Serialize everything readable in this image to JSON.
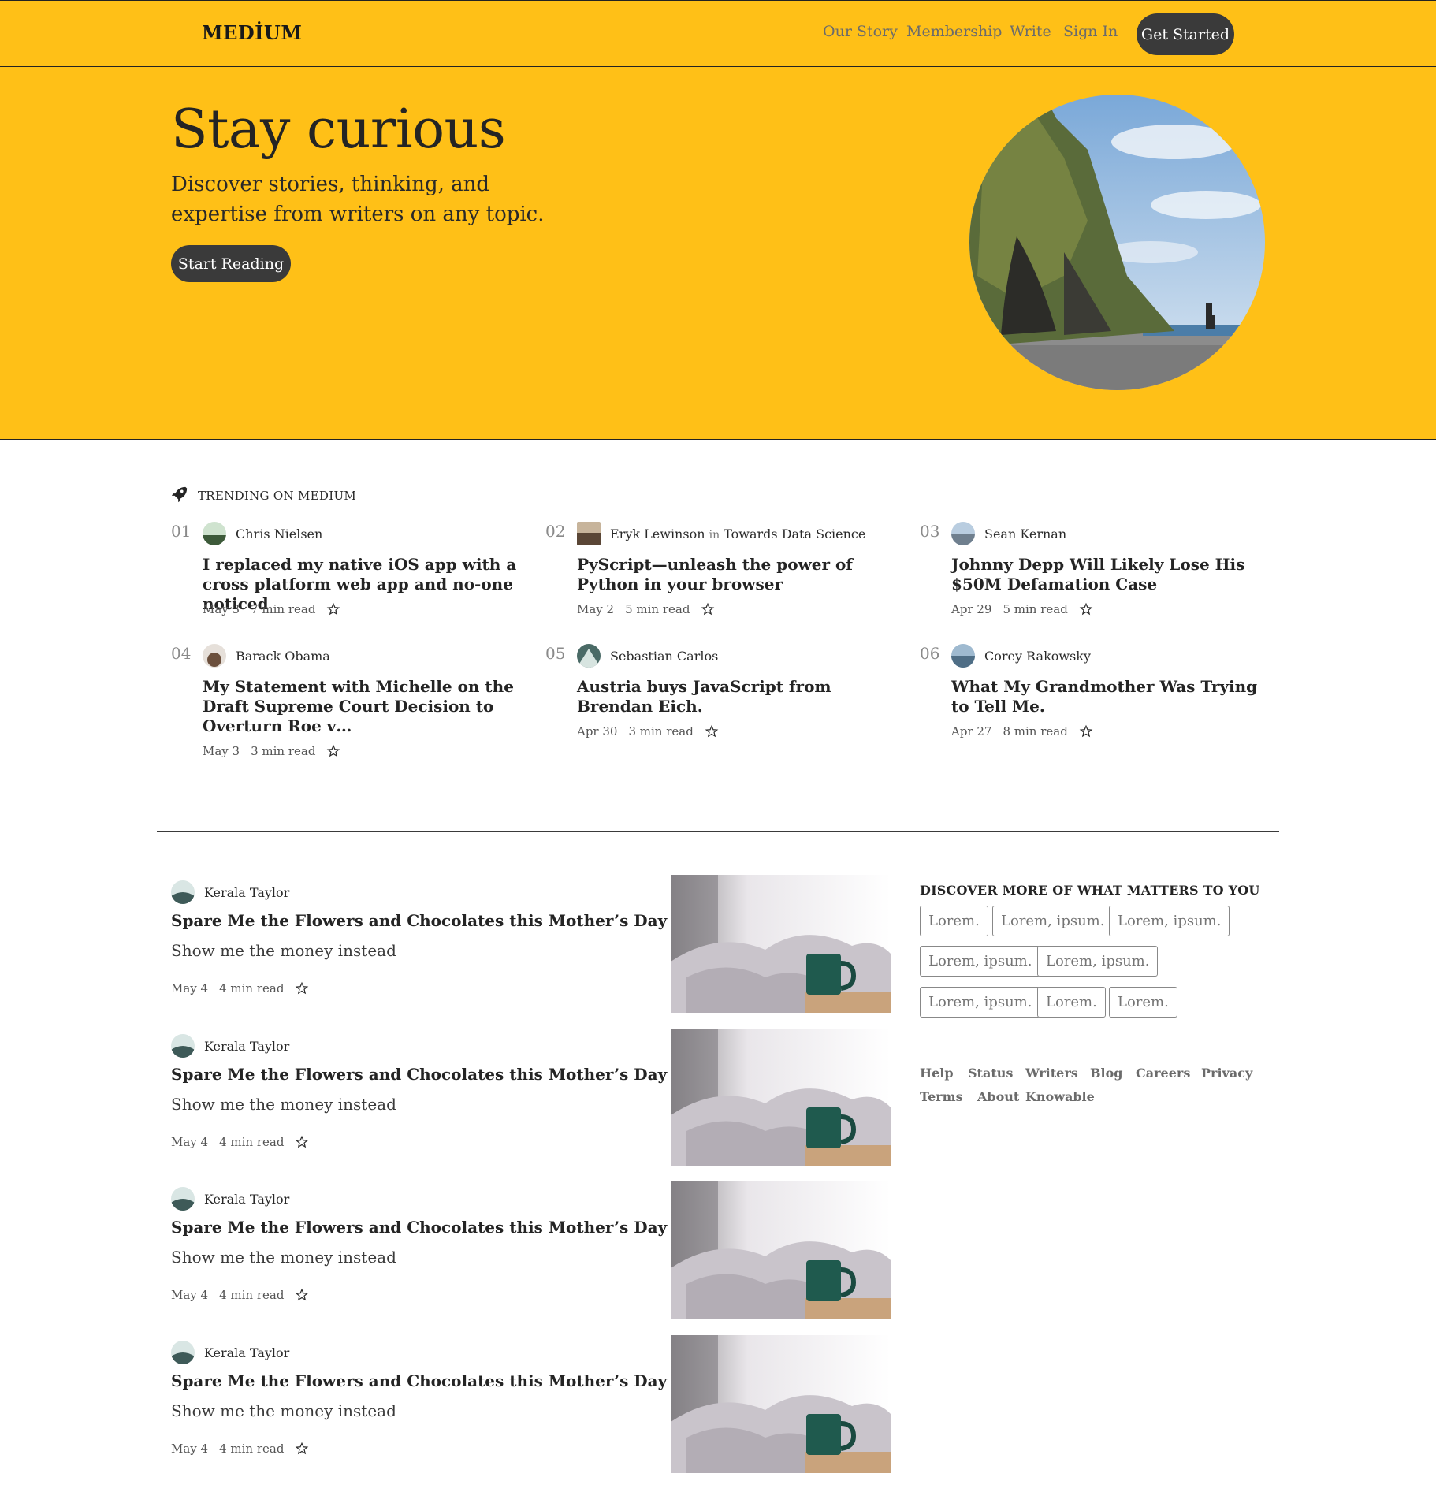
{
  "nav": {
    "logo": "MEDİUM",
    "links": [
      "Our Story",
      "Membership",
      "Write",
      "Sign In"
    ],
    "cta": "Get Started"
  },
  "hero": {
    "title": "Stay curious",
    "subtitle": "Discover stories, thinking, and expertise from writers on any topic.",
    "button": "Start Reading"
  },
  "trending": {
    "heading": "TRENDING ON MEDIUM",
    "items": [
      {
        "num": "01",
        "author": "Chris Nielsen",
        "in": "",
        "publication": "",
        "title": "I replaced my native iOS app with a cross platform web app and no-one noticed",
        "date": "May 3",
        "read": "7 min read"
      },
      {
        "num": "02",
        "author": "Eryk Lewinson",
        "in": "in",
        "publication": "Towards Data Science",
        "title": "PyScript—unleash the power of Python in your browser",
        "date": "May 2",
        "read": "5 min read"
      },
      {
        "num": "03",
        "author": "Sean Kernan",
        "in": "",
        "publication": "",
        "title": "Johnny Depp Will Likely Lose His $50M Defamation Case",
        "date": "Apr 29",
        "read": "5 min read"
      },
      {
        "num": "04",
        "author": "Barack Obama",
        "in": "",
        "publication": "",
        "title": "My Statement with Michelle on the Draft Supreme Court Decision to Overturn Roe v…",
        "date": "May 3",
        "read": "3 min read"
      },
      {
        "num": "05",
        "author": "Sebastian Carlos",
        "in": "",
        "publication": "",
        "title": "Austria buys JavaScript from Brendan Eich.",
        "date": "Apr 30",
        "read": "3 min read"
      },
      {
        "num": "06",
        "author": "Corey Rakowsky",
        "in": "",
        "publication": "",
        "title": "What My Grandmother Was Trying to Tell Me.",
        "date": "Apr 27",
        "read": "8 min read"
      }
    ]
  },
  "feed": {
    "posts": [
      {
        "author": "Kerala Taylor",
        "title": "Spare Me the Flowers and Chocolates this Mother’s Day",
        "subtitle": "Show me the money instead",
        "date": "May 4",
        "read": "4 min read"
      },
      {
        "author": "Kerala Taylor",
        "title": "Spare Me the Flowers and Chocolates this Mother’s Day",
        "subtitle": "Show me the money instead",
        "date": "May 4",
        "read": "4 min read"
      },
      {
        "author": "Kerala Taylor",
        "title": "Spare Me the Flowers and Chocolates this Mother’s Day",
        "subtitle": "Show me the money instead",
        "date": "May 4",
        "read": "4 min read"
      },
      {
        "author": "Kerala Taylor",
        "title": "Spare Me the Flowers and Chocolates this Mother’s Day",
        "subtitle": "Show me the money instead",
        "date": "May 4",
        "read": "4 min read"
      }
    ]
  },
  "sidebar": {
    "heading": "DISCOVER MORE OF WHAT MATTERS TO YOU",
    "tags": [
      "Lorem.",
      "Lorem, ipsum.",
      "Lorem, ipsum.",
      "Lorem, ipsum.",
      "Lorem, ipsum.",
      "Lorem, ipsum.",
      "Lorem.",
      "Lorem."
    ],
    "footer_links": [
      "Help",
      "Status",
      "Writers",
      "Blog",
      "Careers",
      "Privacy",
      "Terms",
      "About",
      "Knowable"
    ]
  },
  "icons": {
    "trending": "rocket-icon",
    "bookmark": "star-icon"
  },
  "colors": {
    "brand_yellow": "#FFC017",
    "dark_button": "#3a3a3a"
  }
}
